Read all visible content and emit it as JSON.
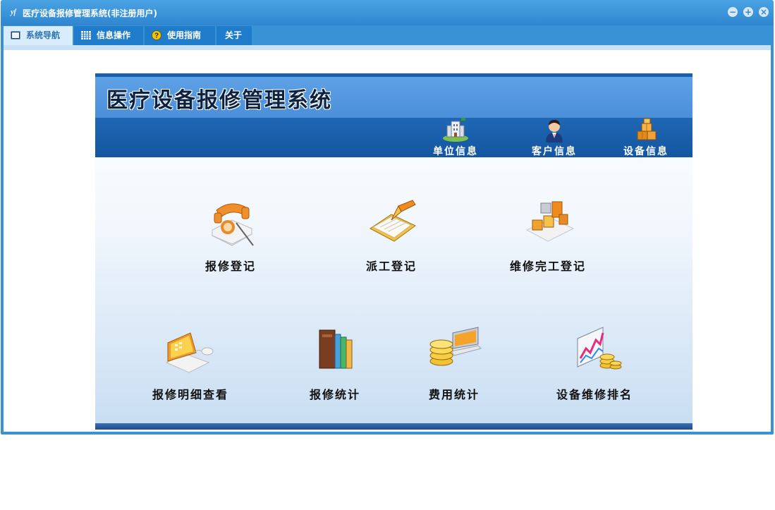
{
  "window": {
    "app_icon": "yf",
    "title": "医疗设备报修管理系统(非注册用户)",
    "controls": {
      "minimize": "−",
      "maximize": "+",
      "close": "×"
    }
  },
  "tabs": [
    {
      "label": "系统导航",
      "icon": "monitor-icon",
      "active": true
    },
    {
      "label": "信息操作",
      "icon": "grid-icon",
      "active": false
    },
    {
      "label": "使用指南",
      "icon": "help-icon",
      "active": false
    },
    {
      "label": "关于",
      "icon": "",
      "active": false
    }
  ],
  "panel": {
    "title": "医疗设备报修管理系统",
    "quick_links": [
      {
        "label": "单位信息",
        "icon": "building-icon"
      },
      {
        "label": "客户信息",
        "icon": "user-icon"
      },
      {
        "label": "设备信息",
        "icon": "boxes-icon"
      }
    ],
    "modules_row1": [
      {
        "label": "报修登记",
        "icon": "telephone-icon"
      },
      {
        "label": "派工登记",
        "icon": "notepad-icon"
      },
      {
        "label": "维修完工登记",
        "icon": "blocks-icon"
      }
    ],
    "modules_row2": [
      {
        "label": "报修明细查看",
        "icon": "laptop-icon"
      },
      {
        "label": "报修统计",
        "icon": "books-icon"
      },
      {
        "label": "费用统计",
        "icon": "coins-icon"
      },
      {
        "label": "设备维修排名",
        "icon": "chart-icon"
      }
    ]
  },
  "colors": {
    "window_blue": "#3a92d6",
    "tab_active_bg": "#d9ecfb",
    "header_blue": "#4b8fda",
    "band_blue": "#1456a0"
  }
}
